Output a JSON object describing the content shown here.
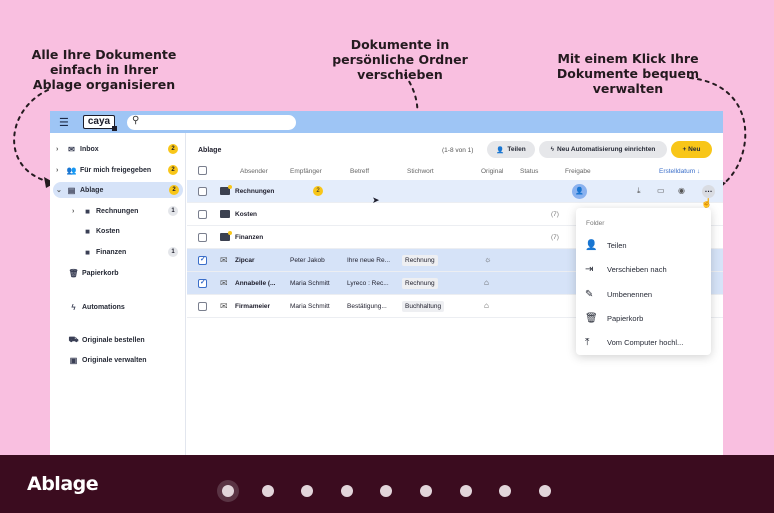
{
  "annotations": {
    "left": "Alle Ihre Dokumente einfach in Ihrer Ablage organisieren",
    "middle": "Dokumente in persönliche Ordner verschieben",
    "right": "Mit einem Klick Ihre Dokumente bequem verwalten"
  },
  "app": {
    "logo": "caya",
    "sidebar": {
      "items": [
        {
          "label": "Inbox",
          "badge": "2"
        },
        {
          "label": "Für mich freigegeben",
          "badge": "2"
        },
        {
          "label": "Ablage",
          "badge": "2"
        },
        {
          "label": "Rechnungen",
          "badge": "1"
        },
        {
          "label": "Kosten",
          "badge": ""
        },
        {
          "label": "Finanzen",
          "badge": "1"
        },
        {
          "label": "Papierkorb",
          "badge": ""
        },
        {
          "label": "Automations",
          "badge": ""
        },
        {
          "label": "Originale bestellen",
          "badge": ""
        },
        {
          "label": "Originale verwalten",
          "badge": ""
        }
      ]
    },
    "main": {
      "title": "Ablage",
      "count": "(1-8 von 1)",
      "share_label": "Teilen",
      "automation_label": "Neu Automatisierung einrichten",
      "new_label": "+ Neu",
      "columns": [
        "Absender",
        "Empfänger",
        "Betreff",
        "Stichwort",
        "Original",
        "Status",
        "Freigabe",
        "Erstelldatum ↓"
      ],
      "rows": [
        {
          "name": "Rechnungen",
          "badge": "2",
          "empfaenger": "",
          "betreff": "",
          "stichwort": "",
          "count": ""
        },
        {
          "name": "Kosten",
          "badge": "",
          "empfaenger": "",
          "betreff": "",
          "stichwort": "",
          "count": "(7)"
        },
        {
          "name": "Finanzen",
          "badge": "",
          "empfaenger": "",
          "betreff": "",
          "stichwort": "",
          "count": "(7)"
        },
        {
          "name": "Zipcar",
          "badge": "",
          "empfaenger": "Peter Jakob",
          "betreff": "Ihre neue Re...",
          "stichwort": "Rechnung",
          "count": ""
        },
        {
          "name": "Annabelle (...",
          "badge": "",
          "empfaenger": "Maria Schmitt",
          "betreff": "Lyreco : Rec...",
          "stichwort": "Rechnung",
          "count": ""
        },
        {
          "name": "Firmameier",
          "badge": "",
          "empfaenger": "Maria Schmitt",
          "betreff": "Bestätigung...",
          "stichwort": "Buchhaltung",
          "count": ""
        }
      ]
    },
    "dropdown": {
      "header": "Folder",
      "items": [
        "Teilen",
        "Verschieben nach",
        "Umbenennen",
        "Papierkorb",
        "Vom Computer hochl..."
      ]
    }
  },
  "footer": {
    "title": "Ablage",
    "slide_count": 9,
    "active_slide": 1
  },
  "colors": {
    "background": "#f9bfe0",
    "topbar": "#9ec5f5",
    "accent_yellow": "#f8c619",
    "footer": "#3b0c1f"
  }
}
